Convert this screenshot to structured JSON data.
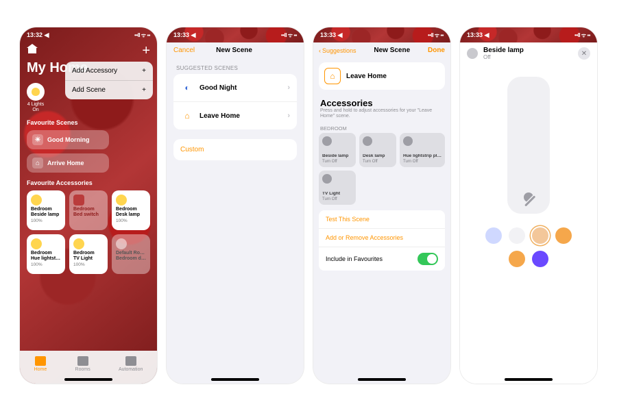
{
  "status": {
    "time1": "13:32 ◀",
    "time234": "13:33 ◀",
    "indicators": "••ll ᯤ ▪▪"
  },
  "screen1": {
    "title": "My Home",
    "popup": {
      "item1": "Add Accessory",
      "item2": "Add Scene",
      "plus": "+"
    },
    "lights_summary": "4 Lights\nOn",
    "favScenesHeader": "Favourite Scenes",
    "scenes": [
      {
        "icon": "☀",
        "label": "Good Morning"
      },
      {
        "icon": "⌂",
        "label": "Arrive Home"
      }
    ],
    "favAccHeader": "Favourite Accessories",
    "tiles": [
      {
        "name": "Bedroom\nBeside lamp",
        "sub": "100%",
        "kind": "on"
      },
      {
        "name": "Bedroom\nBed switch",
        "sub": "",
        "kind": "red"
      },
      {
        "name": "Bedroom\nDesk lamp",
        "sub": "100%",
        "kind": "on"
      },
      {
        "name": "Bedroom\nHue lightst…",
        "sub": "100%",
        "kind": "on"
      },
      {
        "name": "Bedroom\nTV Light",
        "sub": "100%",
        "kind": "on"
      },
      {
        "name": "Default Ro…\nBedroom d…",
        "sub": "",
        "kind": "dim"
      }
    ],
    "tabs": {
      "home": "Home",
      "rooms": "Rooms",
      "automation": "Automation"
    }
  },
  "screen2": {
    "cancel": "Cancel",
    "title": "New Scene",
    "groupHeader": "SUGGESTED SCENES",
    "rows": [
      {
        "icon": "🌙",
        "label": "Good Night"
      },
      {
        "icon": "🏠",
        "label": "Leave Home"
      }
    ],
    "custom": "Custom"
  },
  "screen3": {
    "back": "Suggestions",
    "title": "New Scene",
    "done": "Done",
    "scene": {
      "label": "Leave Home"
    },
    "accHeader": "Accessories",
    "accSub": "Press and hold to adjust accessories for your \"Leave Home\" scene.",
    "roomHeader": "BEDROOM",
    "tiles": [
      {
        "name": "Beside lamp",
        "sub": "Turn Off"
      },
      {
        "name": "Desk lamp",
        "sub": "Turn Off"
      },
      {
        "name": "Hue lightstrip pl…",
        "sub": "Turn Off"
      },
      {
        "name": "TV Light",
        "sub": "Turn Off"
      }
    ],
    "testLink": "Test This Scene",
    "addLink": "Add or Remove Accessories",
    "favLabel": "Include in Favourites"
  },
  "screen4": {
    "title": "Beside lamp",
    "state": "Off",
    "swatches": [
      "#cfd8ff",
      "#f2f2f5",
      "#f3c79a",
      "#f5a74b",
      "#f5a74b",
      "#6a49ff"
    ],
    "selectedSwatch": 2
  }
}
